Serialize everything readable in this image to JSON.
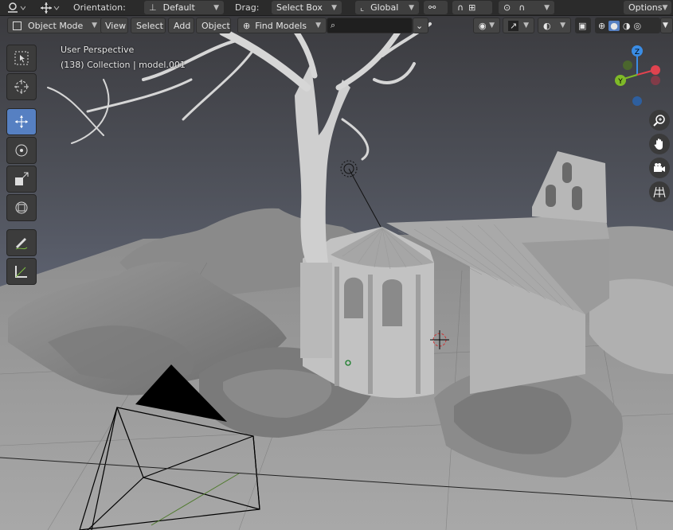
{
  "header": {
    "orientation_label": "Orientation:",
    "orientation_value": "Default",
    "drag_label": "Drag:",
    "drag_value": "Select Box",
    "transform_space": "Global",
    "options_label": "Options"
  },
  "viewport_header": {
    "mode": "Object Mode",
    "menu": [
      "View",
      "Select",
      "Add",
      "Object"
    ],
    "find_models": "Find Models"
  },
  "overlay": {
    "perspective": "User Perspective",
    "collection_info": "(138) Collection | model.001"
  },
  "gizmo": {
    "axes": [
      "Z",
      "Y"
    ],
    "colors": {
      "x": "#e0434f",
      "y": "#7fba28",
      "z": "#3a8de6"
    }
  },
  "toolbar_tools": [
    "select-box",
    "cursor",
    "move",
    "rotate",
    "scale",
    "transform",
    "annotate",
    "measure"
  ],
  "nav_controls": [
    "zoom",
    "pan",
    "camera",
    "grid-view"
  ],
  "colors": {
    "accent": "#5680c2",
    "background": "#3a3a3a",
    "header": "#2b2b2b"
  }
}
